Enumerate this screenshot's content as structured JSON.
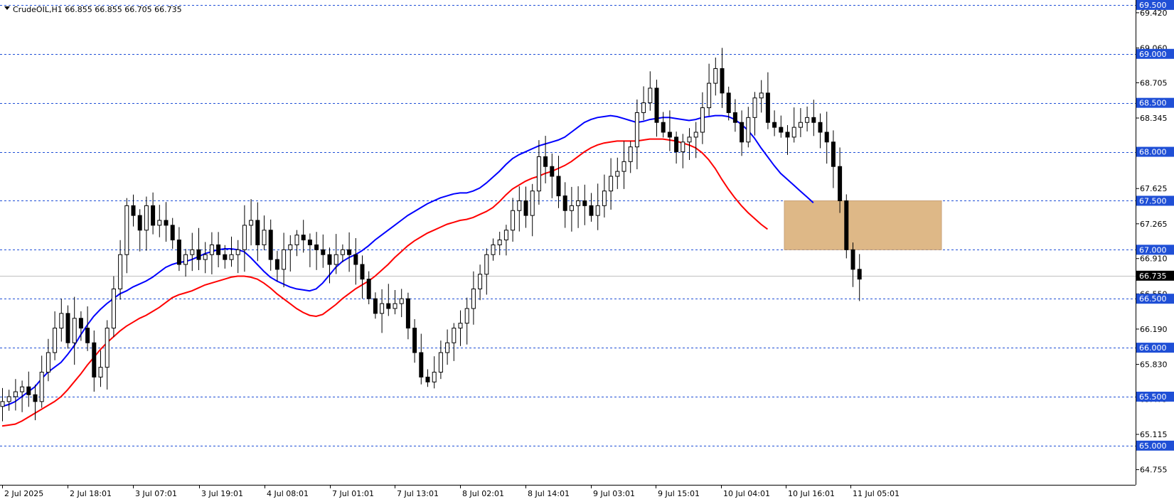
{
  "header": {
    "symbol_label": "CrudeOIL,H1  66.855 66.855 66.705 66.735"
  },
  "chart_data": {
    "type": "candlestick",
    "symbol": "CrudeOIL",
    "timeframe": "H1",
    "ohlc_last": {
      "open": 66.855,
      "high": 66.855,
      "low": 66.705,
      "close": 66.735
    },
    "current_price": 66.735,
    "ylim": [
      64.6,
      69.55
    ],
    "y_ticks": [
      69.42,
      69.06,
      68.705,
      68.345,
      67.985,
      67.625,
      67.265,
      66.91,
      66.55,
      66.19,
      65.83,
      65.475,
      65.115,
      64.755
    ],
    "y_tick_labels": [
      "69.420",
      "69.060",
      "68.705",
      "68.345",
      "67.985",
      "67.625",
      "67.265",
      "66.910",
      "66.550",
      "66.190",
      "65.830",
      "65.475",
      "65.115",
      "64.755"
    ],
    "x_tick_labels": [
      "2 Jul 2025",
      "2 Jul 18:01",
      "3 Jul 07:01",
      "3 Jul 19:01",
      "4 Jul 08:01",
      "7 Jul 01:01",
      "7 Jul 13:01",
      "8 Jul 02:01",
      "8 Jul 14:01",
      "9 Jul 03:01",
      "9 Jul 15:01",
      "10 Jul 04:01",
      "10 Jul 16:01",
      "11 Jul 05:01"
    ],
    "levels": [
      {
        "value": 69.5,
        "label": "69.500"
      },
      {
        "value": 69.0,
        "label": "69.000"
      },
      {
        "value": 68.5,
        "label": "68.500"
      },
      {
        "value": 68.0,
        "label": "68.000"
      },
      {
        "value": 67.5,
        "label": "67.500"
      },
      {
        "value": 67.0,
        "label": "67.000"
      },
      {
        "value": 66.5,
        "label": "66.500"
      },
      {
        "value": 66.0,
        "label": "66.000"
      },
      {
        "value": 65.5,
        "label": "65.500"
      },
      {
        "value": 65.0,
        "label": "65.000"
      }
    ],
    "zone": {
      "low": 67.0,
      "high": 67.5,
      "start_index": 120,
      "end_index": 155
    },
    "grid": false,
    "colors": {
      "bull_candle": "#ffffff",
      "bear_candle": "#000000",
      "fast_ma": "#0000ff",
      "slow_ma": "#ff0000",
      "level_line": "#1f4fd6",
      "zone": "#deb887",
      "price_label_bg": "#000000",
      "level_label_bg": "#1f4fd6"
    },
    "ma_fast": [
      65.4,
      65.42,
      65.45,
      65.5,
      65.55,
      65.6,
      65.68,
      65.75,
      65.8,
      65.85,
      65.93,
      66.02,
      66.13,
      66.23,
      66.32,
      66.39,
      66.45,
      66.5,
      66.55,
      66.58,
      66.62,
      66.65,
      66.68,
      66.72,
      66.77,
      66.82,
      66.85,
      66.87,
      66.88,
      66.9,
      66.93,
      66.96,
      66.98,
      67.0,
      67.01,
      67.01,
      67.0,
      66.98,
      66.92,
      66.85,
      66.78,
      66.72,
      66.68,
      66.65,
      66.62,
      66.6,
      66.59,
      66.58,
      66.6,
      66.66,
      66.74,
      66.82,
      66.88,
      66.92,
      66.95,
      66.99,
      67.04,
      67.1,
      67.15,
      67.2,
      67.25,
      67.3,
      67.35,
      67.39,
      67.43,
      67.47,
      67.5,
      67.53,
      67.55,
      67.57,
      67.58,
      67.58,
      67.6,
      67.63,
      67.68,
      67.74,
      67.8,
      67.87,
      67.93,
      67.97,
      68.0,
      68.03,
      68.06,
      68.08,
      68.1,
      68.12,
      68.15,
      68.2,
      68.25,
      68.3,
      68.33,
      68.35,
      68.36,
      68.37,
      68.36,
      68.34,
      68.32,
      68.3,
      68.31,
      68.33,
      68.34,
      68.35,
      68.35,
      68.34,
      68.33,
      68.32,
      68.33,
      68.35,
      68.36,
      68.37,
      68.37,
      68.36,
      68.33,
      68.28,
      68.22,
      68.14,
      68.04,
      67.95,
      67.86,
      67.78,
      67.72,
      67.66,
      67.6,
      67.54,
      67.48
    ],
    "ma_slow": [
      65.2,
      65.21,
      65.22,
      65.25,
      65.29,
      65.33,
      65.37,
      65.41,
      65.45,
      65.5,
      65.57,
      65.65,
      65.73,
      65.82,
      65.9,
      65.98,
      66.05,
      66.11,
      66.17,
      66.22,
      66.26,
      66.3,
      66.33,
      66.37,
      66.41,
      66.46,
      66.51,
      66.54,
      66.56,
      66.58,
      66.61,
      66.64,
      66.66,
      66.68,
      66.7,
      66.72,
      66.73,
      66.73,
      66.72,
      66.7,
      66.66,
      66.61,
      66.55,
      66.5,
      66.45,
      66.4,
      66.36,
      66.33,
      66.32,
      66.34,
      66.39,
      66.44,
      66.5,
      66.55,
      66.6,
      66.64,
      66.68,
      66.73,
      66.79,
      66.85,
      66.92,
      66.98,
      67.04,
      67.09,
      67.13,
      67.17,
      67.2,
      67.23,
      67.26,
      67.28,
      67.3,
      67.31,
      67.33,
      67.36,
      67.39,
      67.43,
      67.49,
      67.56,
      67.62,
      67.66,
      67.7,
      67.73,
      67.75,
      67.78,
      67.8,
      67.83,
      67.86,
      67.9,
      67.95,
      68.0,
      68.04,
      68.07,
      68.09,
      68.1,
      68.11,
      68.11,
      68.11,
      68.11,
      68.12,
      68.13,
      68.13,
      68.13,
      68.12,
      68.11,
      68.09,
      68.07,
      68.04,
      67.99,
      67.92,
      67.83,
      67.72,
      67.62,
      67.53,
      67.45,
      67.38,
      67.32,
      67.26,
      67.21
    ]
  }
}
